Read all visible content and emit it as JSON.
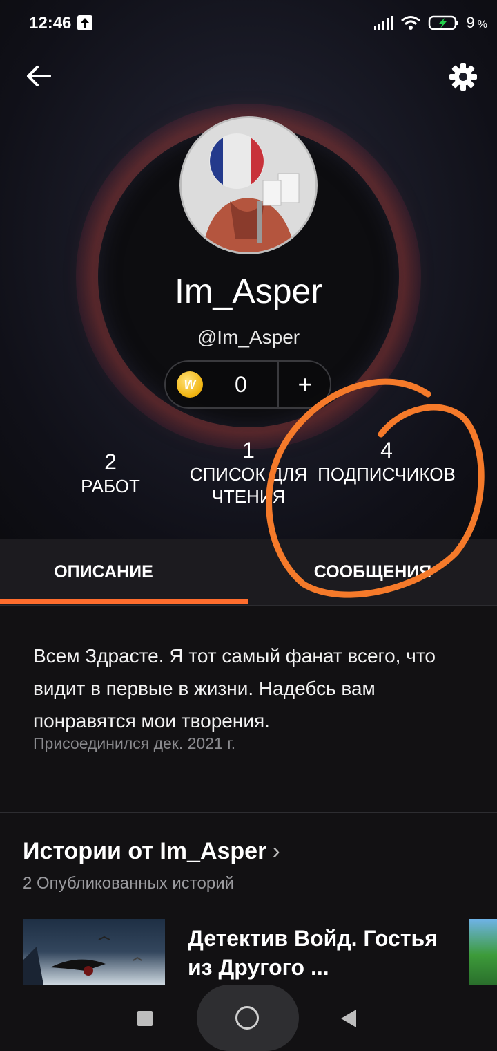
{
  "status_bar": {
    "time": "12:46",
    "battery": "9",
    "battery_unit": "%"
  },
  "profile": {
    "display_name": "Im_Asper",
    "username": "@Im_Asper",
    "coins": "0",
    "coin_add": "+",
    "coin_letter": "W"
  },
  "stats": {
    "works": {
      "count": "2",
      "label": "РАБОТ"
    },
    "reading_lists": {
      "count": "1",
      "label": "СПИСОК ДЛЯ ЧТЕНИЯ"
    },
    "followers": {
      "count": "4",
      "label": "ПОДПИСЧИКОВ"
    }
  },
  "tabs": {
    "description": "ОПИСАНИЕ",
    "messages": "СООБЩЕНИЯ",
    "active": "description"
  },
  "about": {
    "text": "Всем Здрасте. Я тот самый фанат всего, что видит в первые в жизни. Надебсь вам понравятся мои творения.",
    "joined": "Присоединился дек. 2021 г."
  },
  "stories": {
    "title": "Истории от Im_Asper",
    "chevron": "›",
    "subtitle": "2 Опубликованных историй",
    "items": [
      {
        "title": "Детектив Войд. Гостья из Другого ..."
      }
    ]
  },
  "colors": {
    "accent": "#ff6d2d",
    "annotation": "#f57a2a",
    "background": "#121113"
  },
  "icons": [
    "back-arrow-icon",
    "gear-icon",
    "coin-icon",
    "upload-icon",
    "signal-icon",
    "wifi-icon",
    "battery-icon"
  ]
}
